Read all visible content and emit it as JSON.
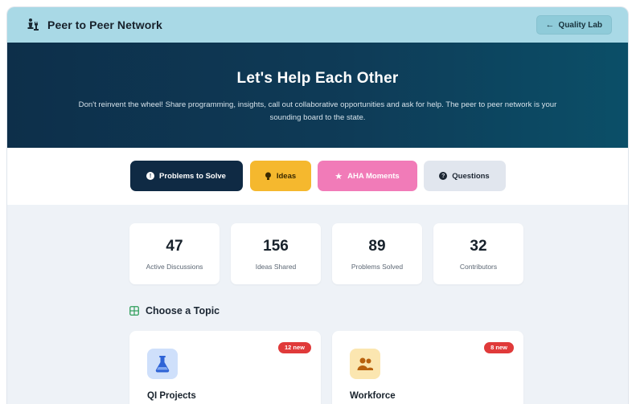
{
  "header": {
    "title": "Peer to Peer Network",
    "brand_icon": "chess-pieces-icon",
    "back_button": {
      "label": "Quality Lab",
      "icon": "arrow-left-icon"
    }
  },
  "hero": {
    "title": "Let's Help Each Other",
    "subtitle": "Don't reinvent the wheel! Share programming, insights, call out collaborative opportunities and ask for help. The peer to peer network is your sounding board to the state."
  },
  "tabs": [
    {
      "label": "Problems to Solve",
      "icon": "exclamation-circle-icon",
      "color": "#0f2a44",
      "active": true
    },
    {
      "label": "Ideas",
      "icon": "lightbulb-icon",
      "color": "#f5b82e"
    },
    {
      "label": "AHA Moments",
      "icon": "star-icon",
      "color": "#f17bb8"
    },
    {
      "label": "Questions",
      "icon": "question-circle-icon",
      "color": "#e1e6ee"
    }
  ],
  "stats": [
    {
      "value": "47",
      "label": "Active Discussions"
    },
    {
      "value": "156",
      "label": "Ideas Shared"
    },
    {
      "value": "89",
      "label": "Problems Solved"
    },
    {
      "value": "32",
      "label": "Contributors"
    }
  ],
  "topics": {
    "heading": "Choose a Topic",
    "heading_icon": "grid-icon",
    "cards": [
      {
        "title": "QI Projects",
        "badge": "12 new",
        "icon": "flask-icon",
        "icon_bg": "#cfe0fb"
      },
      {
        "title": "Workforce",
        "badge": "8 new",
        "icon": "people-icon",
        "icon_bg": "#fbe6b0"
      }
    ]
  },
  "colors": {
    "topbar": "#a9d9e6",
    "hero_dark": "#0d2f4a",
    "badge_red": "#e03a3a",
    "page_bg": "#eef2f7"
  }
}
